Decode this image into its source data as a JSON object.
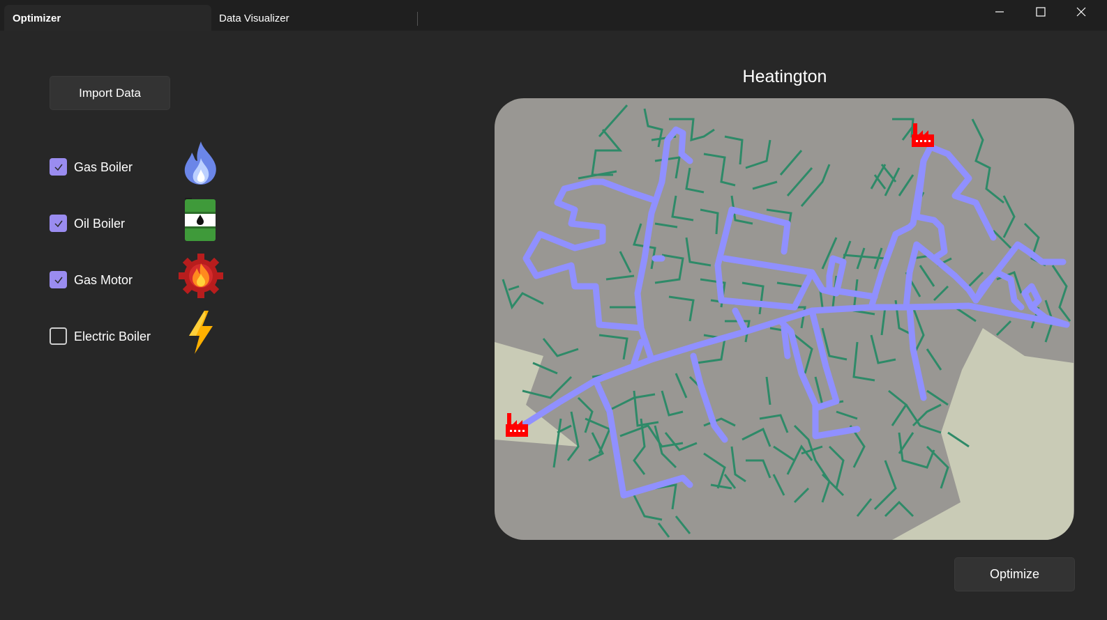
{
  "tabs": [
    {
      "label": "Optimizer",
      "active": true
    },
    {
      "label": "Data Visualizer",
      "active": false
    }
  ],
  "window_controls": [
    "minimize-icon",
    "maximize-icon",
    "close-icon"
  ],
  "actions": {
    "import_label": "Import Data",
    "optimize_label": "Optimize"
  },
  "options": [
    {
      "label": "Gas Boiler",
      "checked": true,
      "icon": "flame-icon"
    },
    {
      "label": "Oil Boiler",
      "checked": true,
      "icon": "oil-barrel-icon"
    },
    {
      "label": "Gas Motor",
      "checked": true,
      "icon": "gear-fire-icon"
    },
    {
      "label": "Electric Boiler",
      "checked": false,
      "icon": "lightning-icon"
    }
  ],
  "map": {
    "title": "Heatington",
    "markers": [
      "factory-icon",
      "factory-icon"
    ]
  },
  "colors": {
    "accent": "#9a8cf0",
    "map_background": "#999793",
    "map_land": "#c9cbb6",
    "street_network": "#2e8a68",
    "heat_pipeline": "#9090ff",
    "factory": "#ff0000"
  }
}
